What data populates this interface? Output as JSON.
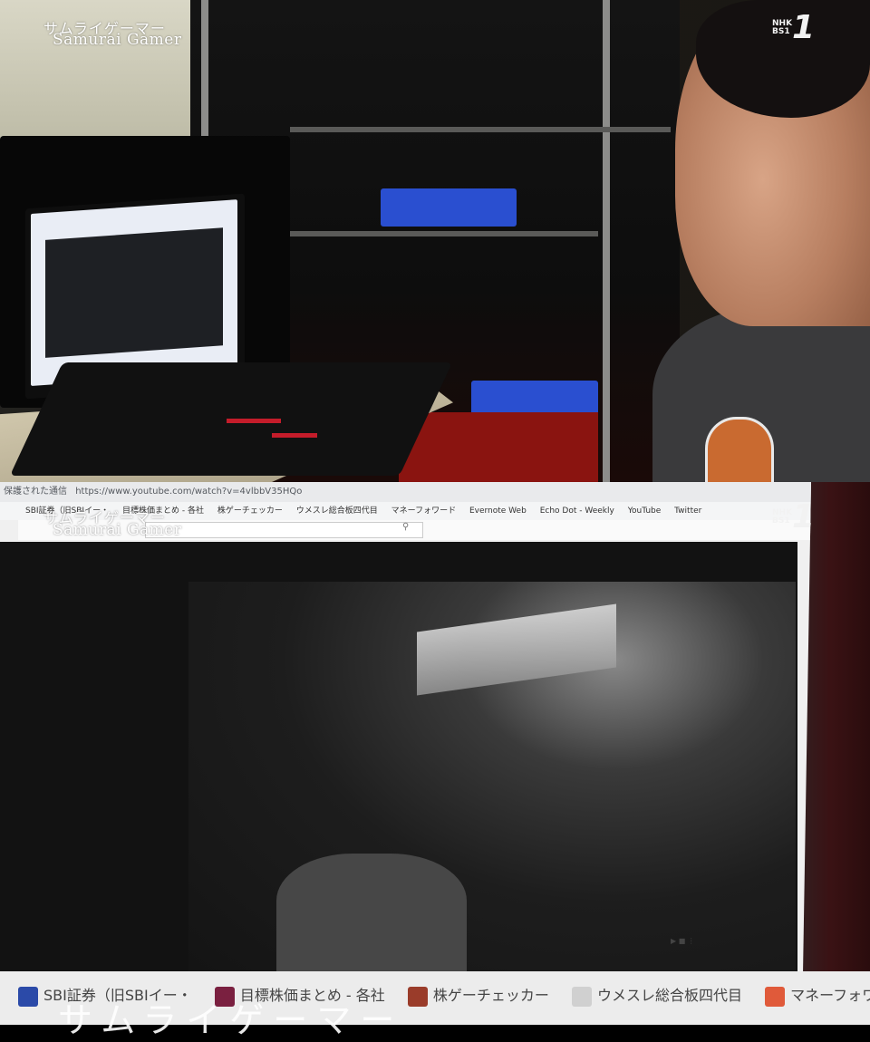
{
  "captions": {
    "japanese": "サムライゲーマー",
    "english": "Samurai Gamer",
    "bottom_partial": "サムライゲーマー"
  },
  "broadcaster": {
    "name": "NHK",
    "channel": "BS1",
    "number": "1"
  },
  "browser": {
    "url_prefix": "保護された通信",
    "url": "https://www.youtube.com/watch?v=4vlbbV35HQo",
    "bookmarks": [
      "SBI証券（旧SBIイー・",
      "目標株価まとめ - 各社",
      "株ゲーチェッカー",
      "ウメスレ総合板四代目",
      "マネーフォワード",
      "Evernote Web",
      "Echo Dot - Weekly",
      "YouTube",
      "Twitter"
    ],
    "large_bookmarks": [
      "SBI証券（旧SBIイー・",
      "目標株価まとめ - 各社",
      "株ゲーチェッカー",
      "ウメスレ総合板四代目",
      "マネーフォワード"
    ]
  },
  "colors": {
    "shelf_blue": "#2a4fd0",
    "cart_red": "#8a1410",
    "laptop_accent": "#c41c2a"
  }
}
